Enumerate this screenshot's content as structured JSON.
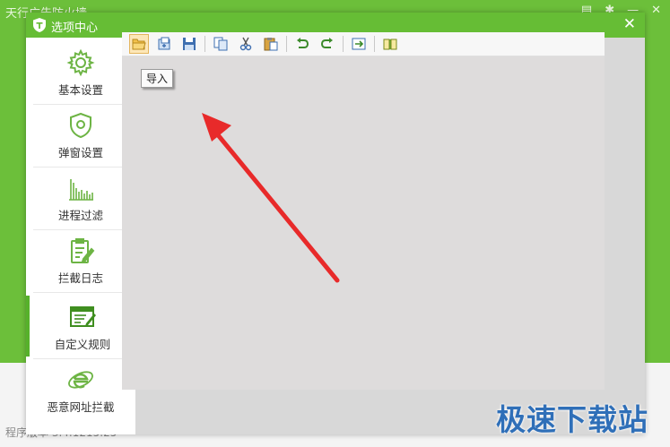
{
  "background_app": {
    "title": "天行广告防火墙",
    "controls": [
      "▤",
      "✱",
      "—",
      "✕"
    ],
    "version_text": "程序版本 3.4.1215.25"
  },
  "watermark": "极速下载站",
  "dialog": {
    "title": "选项中心",
    "close": "✕"
  },
  "sidebar": {
    "items": [
      {
        "label": "基本设置",
        "icon": "gear-icon"
      },
      {
        "label": "弹窗设置",
        "icon": "shield-icon"
      },
      {
        "label": "进程过滤",
        "icon": "bar-chart-icon"
      },
      {
        "label": "拦截日志",
        "icon": "clipboard-edit-icon"
      },
      {
        "label": "自定义规则",
        "icon": "window-edit-icon",
        "active": true
      },
      {
        "label": "恶意网址拦截",
        "icon": "ie-globe-icon"
      }
    ]
  },
  "toolbar": {
    "buttons": [
      "open-folder-icon",
      "import-icon",
      "save-icon",
      "copy-icon",
      "cut-icon",
      "paste-icon",
      "undo-icon",
      "redo-icon",
      "insert-icon",
      "book-icon"
    ]
  },
  "tooltip": "导入",
  "colors": {
    "brand_green": "#66bd35",
    "arrow_red": "#e82a2a"
  }
}
